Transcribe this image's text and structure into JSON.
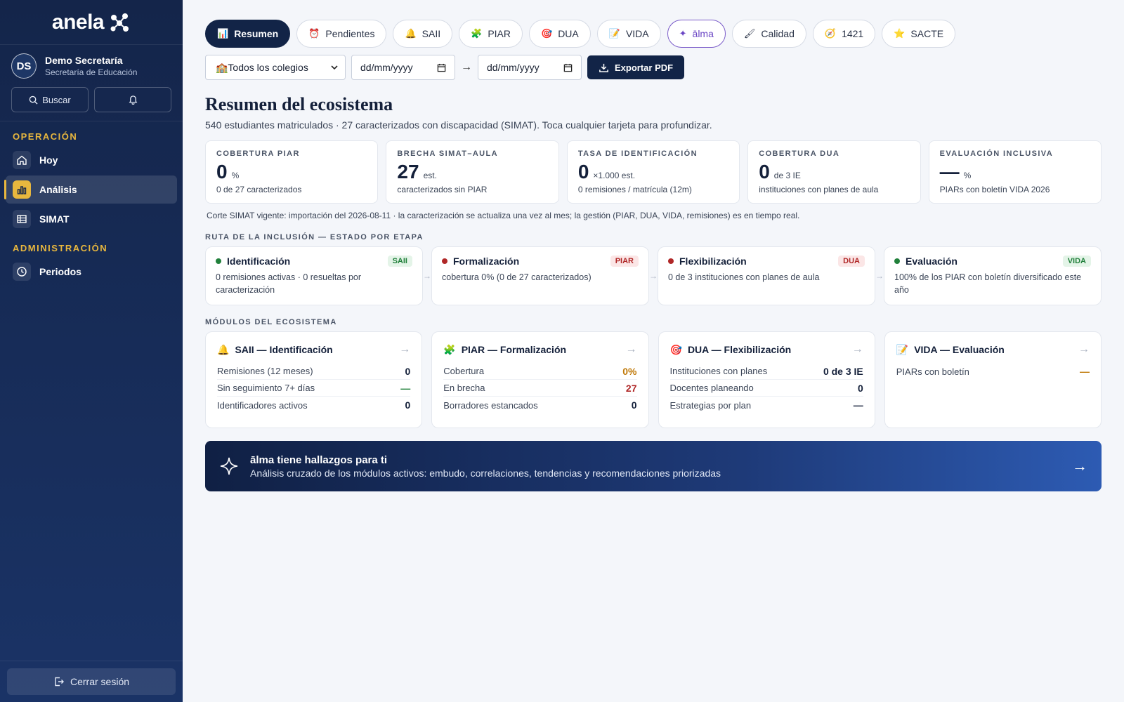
{
  "sidebar": {
    "logo": "anela",
    "user": {
      "initials": "DS",
      "name": "Demo Secretaría",
      "role": "Secretaría de Educación"
    },
    "search_label": "Buscar",
    "sections": [
      {
        "label": "OPERACIÓN",
        "items": [
          {
            "label": "Hoy",
            "icon": "home-icon"
          },
          {
            "label": "Análisis",
            "icon": "bar-chart-icon",
            "active": true
          },
          {
            "label": "SIMAT",
            "icon": "table-icon"
          }
        ]
      },
      {
        "label": "ADMINISTRACIÓN",
        "items": [
          {
            "label": "Periodos",
            "icon": "clock-icon"
          }
        ]
      }
    ],
    "logout_label": "Cerrar sesión"
  },
  "tabs": [
    {
      "label": "Resumen",
      "icon": "📊",
      "active": true
    },
    {
      "label": "Pendientes",
      "icon": "⏰"
    },
    {
      "label": "SAII",
      "icon": "🔔"
    },
    {
      "label": "PIAR",
      "icon": "🧩"
    },
    {
      "label": "DUA",
      "icon": "🎯"
    },
    {
      "label": "VIDA",
      "icon": "📝"
    },
    {
      "label": "ālma",
      "icon": "✦"
    },
    {
      "label": "Calidad",
      "icon": "🖌"
    },
    {
      "label": "1421",
      "icon": "🧭"
    },
    {
      "label": "SACTE",
      "icon": "⭐"
    }
  ],
  "filters": {
    "school_select": "🏫Todos los colegios",
    "date_from": "dd/mm/yyyy",
    "date_to": "dd/mm/yyyy",
    "export_label": "Exportar PDF"
  },
  "page": {
    "title": "Resumen del ecosistema",
    "subtitle": "540 estudiantes matriculados · 27 caracterizados con discapacidad (SIMAT). Toca cualquier tarjeta para profundizar."
  },
  "kpis": [
    {
      "label": "COBERTURA PIAR",
      "value": "0",
      "unit": "%",
      "desc": "0 de 27 caracterizados"
    },
    {
      "label": "BRECHA SIMAT–AULA",
      "value": "27",
      "unit": "est.",
      "desc": "caracterizados sin PIAR"
    },
    {
      "label": "TASA DE IDENTIFICACIÓN",
      "value": "0",
      "unit": "×1.000 est.",
      "desc": "0 remisiones / matrícula (12m)"
    },
    {
      "label": "COBERTURA DUA",
      "value": "0",
      "unit": "de 3 IE",
      "desc": "instituciones con planes de aula"
    },
    {
      "label": "EVALUACIÓN INCLUSIVA",
      "value": "—",
      "unit": "%",
      "desc": "PIARs con boletín VIDA 2026"
    }
  ],
  "cut_note": "Corte SIMAT vigente: importación del 2026-08-11 · la caracterización se actualiza una vez al mes; la gestión (PIAR, DUA, VIDA, remisiones) es en tiempo real.",
  "stages_label": "RUTA DE LA INCLUSIÓN — ESTADO POR ETAPA",
  "stages": [
    {
      "title": "Identificación",
      "badge": "SAII",
      "status": "green",
      "desc": "0 remisiones activas · 0 resueltas por caracterización"
    },
    {
      "title": "Formalización",
      "badge": "PIAR",
      "status": "red",
      "desc": "cobertura 0% (0 de 27 caracterizados)"
    },
    {
      "title": "Flexibilización",
      "badge": "DUA",
      "status": "red",
      "desc": "0 de 3 instituciones con planes de aula"
    },
    {
      "title": "Evaluación",
      "badge": "VIDA",
      "status": "green",
      "desc": "100% de los PIAR con boletín diversificado este año"
    }
  ],
  "modules_label": "MÓDULOS DEL ECOSISTEMA",
  "modules": [
    {
      "title": "SAII — Identificación",
      "icon": "🔔",
      "rows": [
        {
          "label": "Remisiones (12 meses)",
          "value": "0",
          "tone": ""
        },
        {
          "label": "Sin seguimiento 7+ días",
          "value": "—",
          "tone": "green"
        },
        {
          "label": "Identificadores activos",
          "value": "0",
          "tone": ""
        }
      ]
    },
    {
      "title": "PIAR — Formalización",
      "icon": "🧩",
      "rows": [
        {
          "label": "Cobertura",
          "value": "0%",
          "tone": "amber"
        },
        {
          "label": "En brecha",
          "value": "27",
          "tone": "red"
        },
        {
          "label": "Borradores estancados",
          "value": "0",
          "tone": ""
        }
      ]
    },
    {
      "title": "DUA — Flexibilización",
      "icon": "🎯",
      "rows": [
        {
          "label": "Instituciones con planes",
          "value": "0 de 3 IE",
          "tone": ""
        },
        {
          "label": "Docentes planeando",
          "value": "0",
          "tone": ""
        },
        {
          "label": "Estrategias por plan",
          "value": "—",
          "tone": ""
        }
      ]
    },
    {
      "title": "VIDA — Evaluación",
      "icon": "📝",
      "rows": [
        {
          "label": "PIARs con boletín",
          "value": "—",
          "tone": "amber"
        }
      ]
    }
  ],
  "banner": {
    "title": "ālma tiene hallazgos para ti",
    "subtitle": "Análisis cruzado de los módulos activos: embudo, correlaciones, tendencias y recomendaciones priorizadas"
  },
  "colors": {
    "navy": "#122447",
    "accent": "#e8b73e",
    "green": "#21803b",
    "red": "#b02727",
    "amber": "#c07a0a",
    "alma": "#6a45c4"
  }
}
